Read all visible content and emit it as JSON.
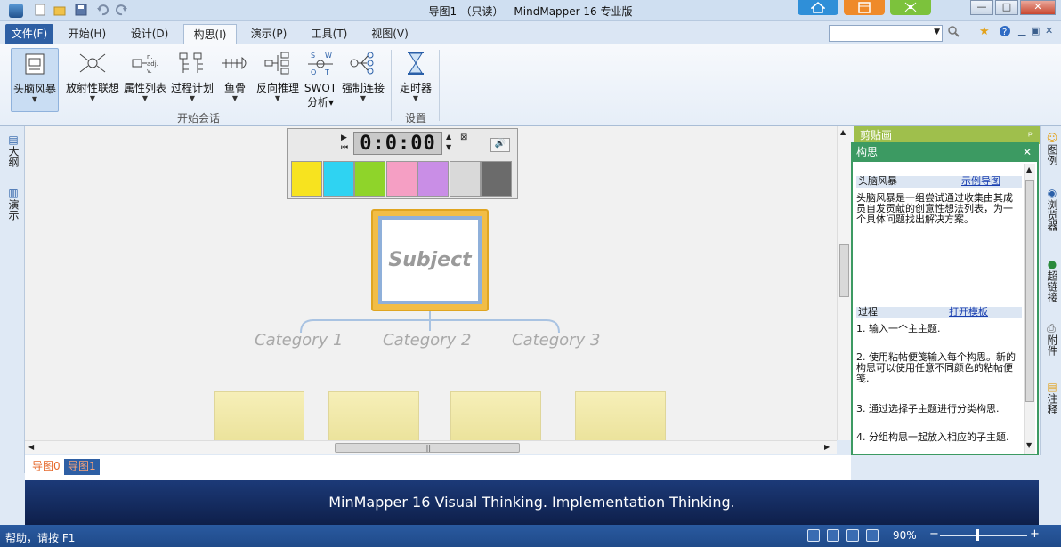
{
  "window": {
    "title": "导图1-（只读） - MindMapper 16 专业版",
    "minimize_label": "—",
    "maximize_label": "□",
    "close_label": "✕"
  },
  "menu": {
    "file": "文件(F)",
    "tabs": [
      "开始(H)",
      "设计(D)",
      "构思(I)",
      "演示(P)",
      "工具(T)",
      "视图(V)"
    ],
    "active_tab": "构思(I)"
  },
  "search": {
    "value": "",
    "placeholder": ""
  },
  "ribbon": {
    "buttons": [
      {
        "label": "头脑风暴",
        "icon": "brainstorm-icon",
        "selected": true
      },
      {
        "label": "放射性联想",
        "icon": "radial-association-icon"
      },
      {
        "label": "属性列表",
        "icon": "attribute-list-icon"
      },
      {
        "label": "过程计划",
        "icon": "process-plan-icon"
      },
      {
        "label": "鱼骨",
        "icon": "fishbone-icon"
      },
      {
        "label": "反向推理",
        "icon": "reverse-reasoning-icon"
      },
      {
        "label": "SWOT",
        "label2": "分析",
        "icon": "swot-icon"
      },
      {
        "label": "强制连接",
        "icon": "forced-connection-icon"
      },
      {
        "label": "定时器",
        "icon": "timer-hourglass-icon"
      }
    ],
    "group_start": "开始会话",
    "group_settings": "设置"
  },
  "left_strip": {
    "outline": "大纲",
    "present": "演示"
  },
  "timer": {
    "display": "0:0:00"
  },
  "swatch_colors": [
    "#f7e31f",
    "#2fd3f2",
    "#8fd42a",
    "#f59fc4",
    "#c98ee6",
    "#d9d9d9",
    "#6b6b6b"
  ],
  "map": {
    "subject": "Subject",
    "categories": [
      "Category 1",
      "Category 2",
      "Category 3"
    ]
  },
  "right_panel": {
    "clipboard_title": "剪贴画",
    "idea_title": "构思",
    "section1_title": "头脑风暴",
    "section1_link": "示例导图",
    "section1_text": "头脑风暴是一组尝试通过收集由其成员自发贡献的创意性想法列表，为一个具体问题找出解决方案。",
    "section2_title": "过程",
    "section2_link": "打开模板",
    "steps": [
      "1. 输入一个主主题.",
      "2. 使用粘帖便笺输入每个构思。新的构思可以使用任意不同颜色的粘帖便笺.",
      "3.  通过选择子主题进行分类构思.",
      "4.  分组构思一起放入相应的子主题."
    ]
  },
  "right_strip": [
    "图例",
    "浏览器",
    "超链接",
    "附件",
    "注释"
  ],
  "map_tabs": [
    "导图0",
    "导图1"
  ],
  "active_map_tab": "导图1",
  "banner_text": "MinMapper 16 Visual Thinking. Implementation Thinking.",
  "status": {
    "text": "帮助，请按 F1",
    "zoom": "90%",
    "zoom_fraction": 0.4
  }
}
